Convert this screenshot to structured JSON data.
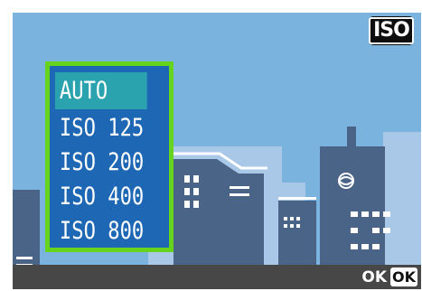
{
  "top_badge": "ISO",
  "iso_menu": {
    "selected_index": 0,
    "items": [
      "AUTO",
      "ISO 125",
      "ISO 200",
      "ISO 400",
      "ISO 800"
    ]
  },
  "bottom_bar": {
    "ok_label": "OK",
    "ok_button": "OK"
  },
  "colors": {
    "sky": "#7ab3de",
    "building_dark": "#4a6488",
    "menu_background": "#1e67b4",
    "menu_selected": "#2aa3af",
    "menu_border": "#66d31c",
    "bottom_bar": "#474747"
  },
  "icons": [
    "iso-icon",
    "ok-button-icon",
    "skyline-illustration"
  ]
}
